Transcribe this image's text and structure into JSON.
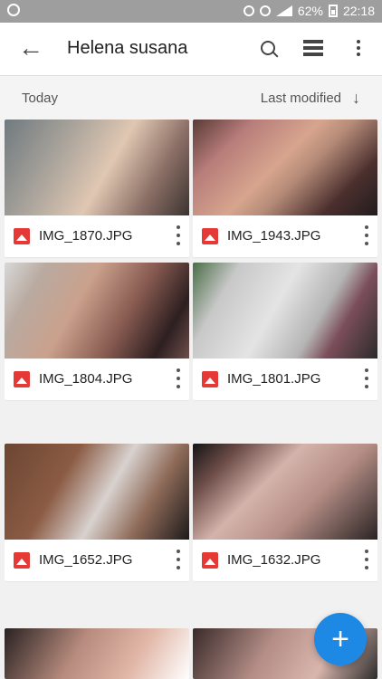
{
  "status_bar": {
    "battery": "62%",
    "time": "22:18"
  },
  "app_bar": {
    "title": "Helena susana",
    "back_icon": "arrow-left-icon",
    "search_icon": "search-icon",
    "view_icon": "list-view-icon",
    "more_icon": "more-vert-icon"
  },
  "sort_bar": {
    "left_label": "Today",
    "right_label": "Last modified",
    "right_icon": "arrow-down-icon"
  },
  "files": [
    {
      "name": "IMG_1870.JPG"
    },
    {
      "name": "IMG_1943.JPG"
    },
    {
      "name": "IMG_1804.JPG"
    },
    {
      "name": "IMG_1801.JPG"
    },
    {
      "name": "IMG_1652.JPG"
    },
    {
      "name": "IMG_1632.JPG"
    }
  ],
  "fab": {
    "label": "+",
    "icon": "plus-icon",
    "color": "#1e88e5"
  },
  "colors": {
    "image_badge": "#e53935",
    "status_bar": "#9e9e9e",
    "background": "#f1f1f1"
  }
}
